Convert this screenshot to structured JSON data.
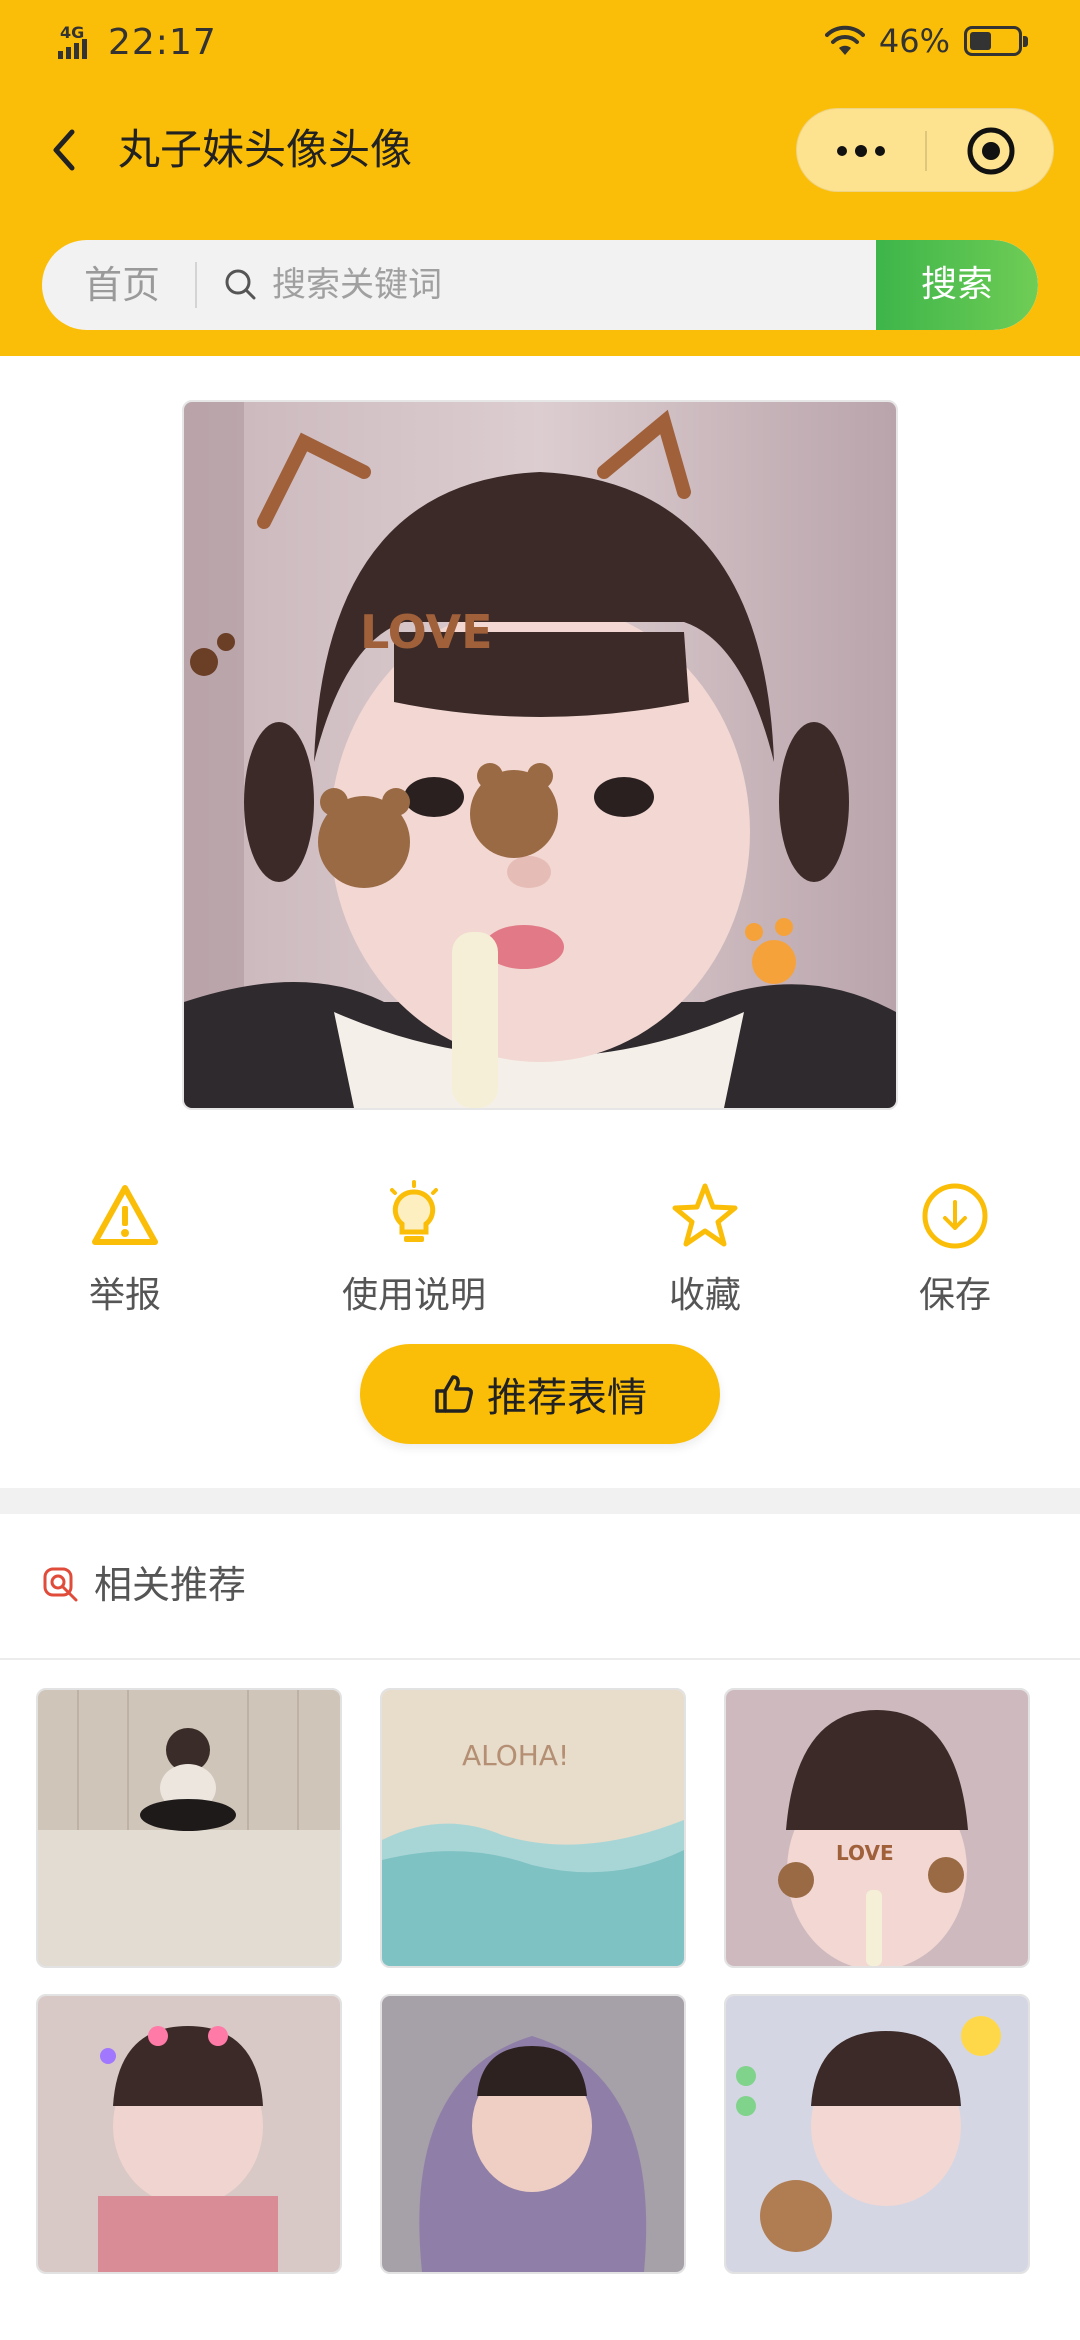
{
  "status_bar": {
    "network": "4G",
    "time": "22:17",
    "battery_percent": "46%",
    "battery_level": 0.46
  },
  "nav": {
    "title": "丸子妹头像头像"
  },
  "search": {
    "home_label": "首页",
    "placeholder": "搜索关键词",
    "button_label": "搜索"
  },
  "actions": [
    {
      "label": "举报",
      "icon": "warning-icon"
    },
    {
      "label": "使用说明",
      "icon": "lightbulb-icon"
    },
    {
      "label": "收藏",
      "icon": "star-icon"
    },
    {
      "label": "保存",
      "icon": "download-icon"
    }
  ],
  "recommend": {
    "label": "推荐表情",
    "icon": "thumbs-up-icon"
  },
  "related": {
    "title": "相关推荐",
    "icon": "search-magnify-icon"
  },
  "main_image": {
    "sticker_text": "LOVE"
  },
  "thumbnails": [
    {
      "desc": "child-sitting-floor"
    },
    {
      "desc": "beach-aloha",
      "text": "ALOHA!"
    },
    {
      "desc": "child-love-stickers",
      "text": "LOVE"
    },
    {
      "desc": "child-heart-stickers"
    },
    {
      "desc": "child-blanket"
    },
    {
      "desc": "child-bear-stickers"
    }
  ],
  "colors": {
    "brand_yellow": "#FBBE08",
    "search_green": "#3db54a"
  }
}
